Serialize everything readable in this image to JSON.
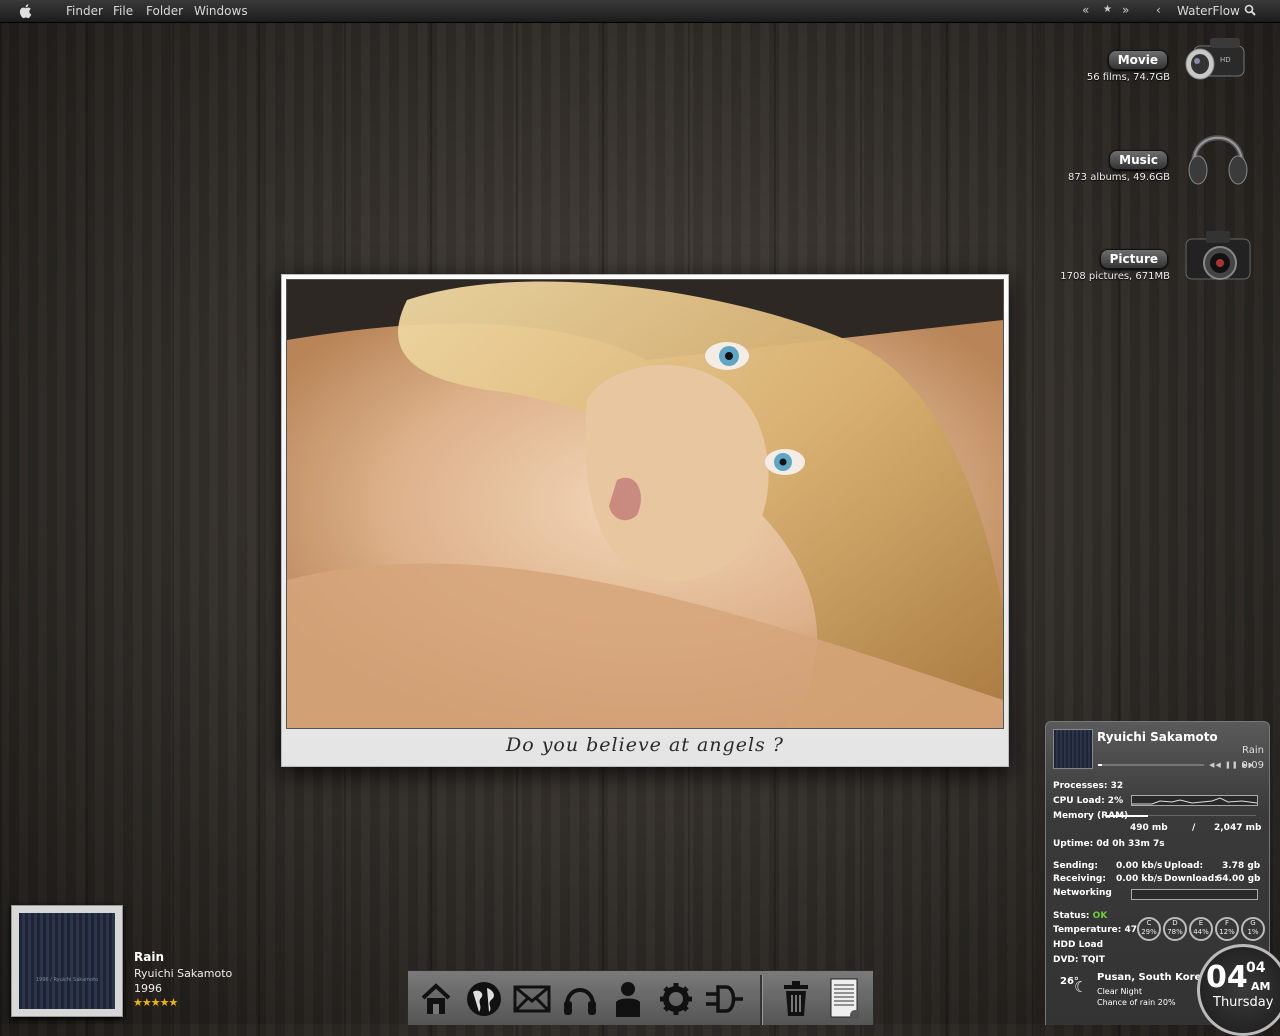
{
  "menubar": {
    "items": [
      "Finder",
      "File",
      "Folder",
      "Windows"
    ],
    "right_glyphs": [
      "«",
      "★",
      "»",
      "‹"
    ],
    "app_name": "WaterFlow"
  },
  "shelf": [
    {
      "label": "Movie",
      "sub": "56 films, 74.7GB",
      "icon": "camcorder-icon"
    },
    {
      "label": "Music",
      "sub": "873 albums, 49.6GB",
      "icon": "headphones-icon"
    },
    {
      "label": "Picture",
      "sub": "1708 pictures, 671MB",
      "icon": "camera-icon"
    }
  ],
  "photo": {
    "caption": "Do you believe at angels ?"
  },
  "now_playing": {
    "title": "Rain",
    "artist": "Ryuichi Sakamoto",
    "year": "1996",
    "stars": "★★★★★",
    "rating": 5,
    "art_text": "1996 / Ryuichi Sakamoto"
  },
  "dock": {
    "icons": [
      "home-icon",
      "globe-icon",
      "mail-icon",
      "headphones-icon",
      "user-icon",
      "gear-icon",
      "plug-icon",
      "trash-icon",
      "document-icon"
    ]
  },
  "panel": {
    "artist": "Ryuichi Sakamoto",
    "track": "Rain",
    "time": "0:09",
    "controls": "◀◀ ❚❚ ▶▶",
    "processes": "Processes: 32",
    "cpu": "CPU Load: 2%",
    "memory": "Memory (RAM)",
    "mem_used": "490 mb",
    "mem_sep": "/",
    "mem_total": "2,047 mb",
    "uptime": "Uptime: 0d 0h 33m 7s",
    "sending": "Sending:",
    "sending_val": "0.00 kb/s",
    "upload": "Upload:",
    "upload_val": "3.78 gb",
    "receiving": "Receiving:",
    "receiving_val": "0.00 kb/s",
    "download": "Download:",
    "download_val": "64.00 gb",
    "networking": "Networking",
    "status_label": "Status:",
    "status_val": "OK",
    "temperature": "Temperature: 47",
    "hdd": "HDD Load",
    "dvd": "DVD: TQIT",
    "drives": [
      {
        "letter": "C",
        "pct": "29%"
      },
      {
        "letter": "D",
        "pct": "78%"
      },
      {
        "letter": "E",
        "pct": "44%"
      },
      {
        "letter": "F",
        "pct": "12%"
      },
      {
        "letter": "G",
        "pct": "1%"
      }
    ],
    "weather": {
      "temp": "26°",
      "city": "Pusan, South Korea",
      "cond": "Clear Night",
      "rain": "Chance of rain 20%"
    },
    "clock": {
      "hour": "04",
      "minute": "04",
      "ampm": "AM",
      "day": "Thursday"
    }
  }
}
